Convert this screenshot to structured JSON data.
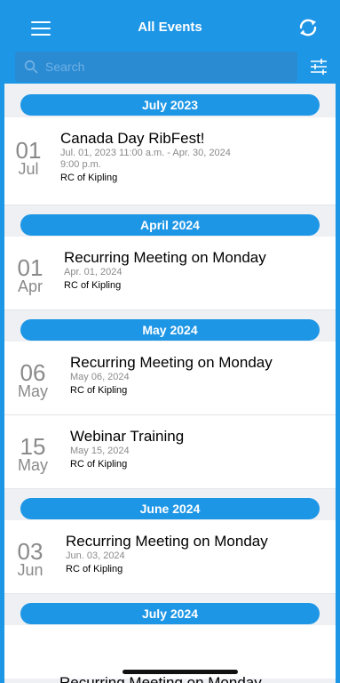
{
  "header": {
    "title": "All Events",
    "menu_icon": "hamburger-menu-icon",
    "sync_icon": "sync-icon",
    "accent_color": "#1e96e6"
  },
  "search": {
    "placeholder": "Search",
    "filter_icon": "filter-sliders-icon"
  },
  "sections": [
    {
      "month": "July 2023",
      "events": [
        {
          "day": "01",
          "month_abbr": "Jul",
          "title": "Canada Day RibFest!",
          "date_range_line1": "Jul. 01, 2023 11:00 a.m. - Apr. 30, 2024",
          "date_range_line2": "9:00 p.m.",
          "org": "RC of Kipling"
        }
      ]
    },
    {
      "month": "April 2024",
      "events": [
        {
          "day": "01",
          "month_abbr": "Apr",
          "title": "Recurring Meeting on Monday",
          "date": "Apr. 01, 2024",
          "org": "RC of Kipling"
        }
      ]
    },
    {
      "month": "May 2024",
      "events": [
        {
          "day": "06",
          "month_abbr": "May",
          "title": "Recurring Meeting on Monday",
          "date": "May 06, 2024",
          "org": "RC of Kipling"
        },
        {
          "day": "15",
          "month_abbr": "May",
          "title": "Webinar Training",
          "date": "May 15, 2024",
          "org": "RC of Kipling"
        }
      ]
    },
    {
      "month": "June 2024",
      "events": [
        {
          "day": "03",
          "month_abbr": "Jun",
          "title": "Recurring Meeting on Monday",
          "date": "Jun. 03, 2024",
          "org": "RC of Kipling"
        }
      ]
    },
    {
      "month": "July 2024",
      "events": [
        {
          "title": "Recurring Meeting on Monday"
        }
      ]
    }
  ]
}
